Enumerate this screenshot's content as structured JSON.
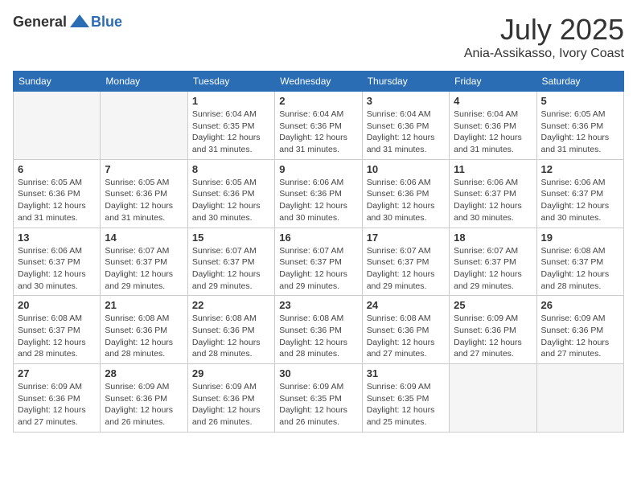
{
  "header": {
    "logo_general": "General",
    "logo_blue": "Blue",
    "month": "July 2025",
    "location": "Ania-Assikasso, Ivory Coast"
  },
  "weekdays": [
    "Sunday",
    "Monday",
    "Tuesday",
    "Wednesday",
    "Thursday",
    "Friday",
    "Saturday"
  ],
  "weeks": [
    [
      {
        "day": null,
        "sunrise": null,
        "sunset": null,
        "daylight": null
      },
      {
        "day": null,
        "sunrise": null,
        "sunset": null,
        "daylight": null
      },
      {
        "day": "1",
        "sunrise": "Sunrise: 6:04 AM",
        "sunset": "Sunset: 6:35 PM",
        "daylight": "Daylight: 12 hours and 31 minutes."
      },
      {
        "day": "2",
        "sunrise": "Sunrise: 6:04 AM",
        "sunset": "Sunset: 6:36 PM",
        "daylight": "Daylight: 12 hours and 31 minutes."
      },
      {
        "day": "3",
        "sunrise": "Sunrise: 6:04 AM",
        "sunset": "Sunset: 6:36 PM",
        "daylight": "Daylight: 12 hours and 31 minutes."
      },
      {
        "day": "4",
        "sunrise": "Sunrise: 6:04 AM",
        "sunset": "Sunset: 6:36 PM",
        "daylight": "Daylight: 12 hours and 31 minutes."
      },
      {
        "day": "5",
        "sunrise": "Sunrise: 6:05 AM",
        "sunset": "Sunset: 6:36 PM",
        "daylight": "Daylight: 12 hours and 31 minutes."
      }
    ],
    [
      {
        "day": "6",
        "sunrise": "Sunrise: 6:05 AM",
        "sunset": "Sunset: 6:36 PM",
        "daylight": "Daylight: 12 hours and 31 minutes."
      },
      {
        "day": "7",
        "sunrise": "Sunrise: 6:05 AM",
        "sunset": "Sunset: 6:36 PM",
        "daylight": "Daylight: 12 hours and 31 minutes."
      },
      {
        "day": "8",
        "sunrise": "Sunrise: 6:05 AM",
        "sunset": "Sunset: 6:36 PM",
        "daylight": "Daylight: 12 hours and 30 minutes."
      },
      {
        "day": "9",
        "sunrise": "Sunrise: 6:06 AM",
        "sunset": "Sunset: 6:36 PM",
        "daylight": "Daylight: 12 hours and 30 minutes."
      },
      {
        "day": "10",
        "sunrise": "Sunrise: 6:06 AM",
        "sunset": "Sunset: 6:36 PM",
        "daylight": "Daylight: 12 hours and 30 minutes."
      },
      {
        "day": "11",
        "sunrise": "Sunrise: 6:06 AM",
        "sunset": "Sunset: 6:37 PM",
        "daylight": "Daylight: 12 hours and 30 minutes."
      },
      {
        "day": "12",
        "sunrise": "Sunrise: 6:06 AM",
        "sunset": "Sunset: 6:37 PM",
        "daylight": "Daylight: 12 hours and 30 minutes."
      }
    ],
    [
      {
        "day": "13",
        "sunrise": "Sunrise: 6:06 AM",
        "sunset": "Sunset: 6:37 PM",
        "daylight": "Daylight: 12 hours and 30 minutes."
      },
      {
        "day": "14",
        "sunrise": "Sunrise: 6:07 AM",
        "sunset": "Sunset: 6:37 PM",
        "daylight": "Daylight: 12 hours and 29 minutes."
      },
      {
        "day": "15",
        "sunrise": "Sunrise: 6:07 AM",
        "sunset": "Sunset: 6:37 PM",
        "daylight": "Daylight: 12 hours and 29 minutes."
      },
      {
        "day": "16",
        "sunrise": "Sunrise: 6:07 AM",
        "sunset": "Sunset: 6:37 PM",
        "daylight": "Daylight: 12 hours and 29 minutes."
      },
      {
        "day": "17",
        "sunrise": "Sunrise: 6:07 AM",
        "sunset": "Sunset: 6:37 PM",
        "daylight": "Daylight: 12 hours and 29 minutes."
      },
      {
        "day": "18",
        "sunrise": "Sunrise: 6:07 AM",
        "sunset": "Sunset: 6:37 PM",
        "daylight": "Daylight: 12 hours and 29 minutes."
      },
      {
        "day": "19",
        "sunrise": "Sunrise: 6:08 AM",
        "sunset": "Sunset: 6:37 PM",
        "daylight": "Daylight: 12 hours and 28 minutes."
      }
    ],
    [
      {
        "day": "20",
        "sunrise": "Sunrise: 6:08 AM",
        "sunset": "Sunset: 6:37 PM",
        "daylight": "Daylight: 12 hours and 28 minutes."
      },
      {
        "day": "21",
        "sunrise": "Sunrise: 6:08 AM",
        "sunset": "Sunset: 6:36 PM",
        "daylight": "Daylight: 12 hours and 28 minutes."
      },
      {
        "day": "22",
        "sunrise": "Sunrise: 6:08 AM",
        "sunset": "Sunset: 6:36 PM",
        "daylight": "Daylight: 12 hours and 28 minutes."
      },
      {
        "day": "23",
        "sunrise": "Sunrise: 6:08 AM",
        "sunset": "Sunset: 6:36 PM",
        "daylight": "Daylight: 12 hours and 28 minutes."
      },
      {
        "day": "24",
        "sunrise": "Sunrise: 6:08 AM",
        "sunset": "Sunset: 6:36 PM",
        "daylight": "Daylight: 12 hours and 27 minutes."
      },
      {
        "day": "25",
        "sunrise": "Sunrise: 6:09 AM",
        "sunset": "Sunset: 6:36 PM",
        "daylight": "Daylight: 12 hours and 27 minutes."
      },
      {
        "day": "26",
        "sunrise": "Sunrise: 6:09 AM",
        "sunset": "Sunset: 6:36 PM",
        "daylight": "Daylight: 12 hours and 27 minutes."
      }
    ],
    [
      {
        "day": "27",
        "sunrise": "Sunrise: 6:09 AM",
        "sunset": "Sunset: 6:36 PM",
        "daylight": "Daylight: 12 hours and 27 minutes."
      },
      {
        "day": "28",
        "sunrise": "Sunrise: 6:09 AM",
        "sunset": "Sunset: 6:36 PM",
        "daylight": "Daylight: 12 hours and 26 minutes."
      },
      {
        "day": "29",
        "sunrise": "Sunrise: 6:09 AM",
        "sunset": "Sunset: 6:36 PM",
        "daylight": "Daylight: 12 hours and 26 minutes."
      },
      {
        "day": "30",
        "sunrise": "Sunrise: 6:09 AM",
        "sunset": "Sunset: 6:35 PM",
        "daylight": "Daylight: 12 hours and 26 minutes."
      },
      {
        "day": "31",
        "sunrise": "Sunrise: 6:09 AM",
        "sunset": "Sunset: 6:35 PM",
        "daylight": "Daylight: 12 hours and 25 minutes."
      },
      {
        "day": null,
        "sunrise": null,
        "sunset": null,
        "daylight": null
      },
      {
        "day": null,
        "sunrise": null,
        "sunset": null,
        "daylight": null
      }
    ]
  ]
}
